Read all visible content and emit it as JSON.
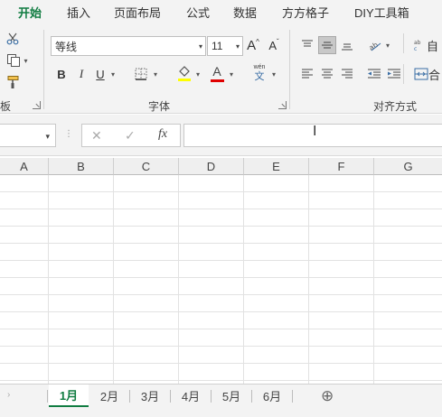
{
  "tabs": [
    "开始",
    "插入",
    "页面布局",
    "公式",
    "数据",
    "方方格子",
    "DIY工具箱"
  ],
  "ribbon": {
    "clipboard_label": "板",
    "font_group_label": "字体",
    "align_group_label": "对齐方式",
    "font_name": "等线",
    "font_size": "11",
    "bold": "B",
    "italic": "I",
    "underline": "U",
    "grow_font": "A",
    "shrink_font": "A",
    "font_color_letter": "A",
    "wen_label": "wén",
    "wen_char": "文",
    "wrap_label": "自",
    "merge_label": "合",
    "colors": {
      "accent": "#107c41",
      "highlight": "#ffff00",
      "font_color": "#e00000"
    }
  },
  "formula_bar": {
    "cancel": "✕",
    "enter": "✓",
    "fx": "fx",
    "value": ""
  },
  "columns": [
    "A",
    "B",
    "C",
    "D",
    "E",
    "F",
    "G"
  ],
  "sheets": [
    "1月",
    "2月",
    "3月",
    "4月",
    "5月",
    "6月"
  ],
  "active_sheet": "1月",
  "add_sheet": "⊕"
}
